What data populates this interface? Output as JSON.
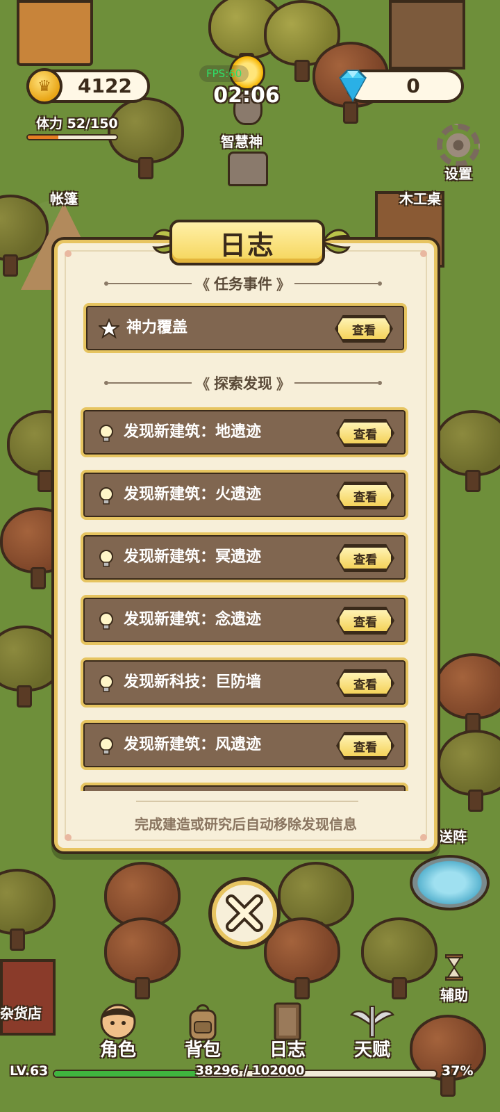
{
  "hud": {
    "coins": "4122",
    "stamina_label": "体力 52/150",
    "stamina_fraction": 0.3467,
    "fps_label": "FPS:60",
    "time": "02:06",
    "gems": "0",
    "settings_label": "设置"
  },
  "scenery": {
    "statue_label": "智慧神",
    "tent_label": "帐篷",
    "workbench_label": "木工桌",
    "portal_label": "送阵",
    "shop_label": "杂货店"
  },
  "dialog": {
    "title": "日志",
    "section_tasks": "任务事件",
    "task_items": [
      {
        "text": "神力覆盖",
        "button": "查看",
        "icon": "star-icon"
      }
    ],
    "section_discoveries": "探索发现",
    "discovery_items": [
      {
        "text": "发现新建筑：地遗迹",
        "button": "查看",
        "icon": "lightbulb-icon"
      },
      {
        "text": "发现新建筑：火遗迹",
        "button": "查看",
        "icon": "lightbulb-icon"
      },
      {
        "text": "发现新建筑：冥遗迹",
        "button": "查看",
        "icon": "lightbulb-icon"
      },
      {
        "text": "发现新建筑：念遗迹",
        "button": "查看",
        "icon": "lightbulb-icon"
      },
      {
        "text": "发现新科技：巨防墙",
        "button": "查看",
        "icon": "lightbulb-icon"
      },
      {
        "text": "发现新建筑：风遗迹",
        "button": "查看",
        "icon": "lightbulb-icon"
      }
    ],
    "footer_note": "完成建造或研究后自动移除发现信息"
  },
  "nav": {
    "assist_label": "辅助",
    "items": [
      {
        "label": "角色",
        "icon": "character-icon"
      },
      {
        "label": "背包",
        "icon": "backpack-icon"
      },
      {
        "label": "日志",
        "icon": "journal-icon"
      },
      {
        "label": "天赋",
        "icon": "talent-wings-icon"
      }
    ]
  },
  "progress": {
    "level": "LV.63",
    "xp_text": "38296 / 102000",
    "xp_percent": "37%",
    "xp_fraction": 0.3755
  },
  "colors": {
    "panel_bg": "#f7efd9",
    "panel_border": "#e7c461",
    "row_bg": "#806650",
    "outline": "#3a2a1a",
    "xp_green": "#3fb53f",
    "stamina_orange": "#e67e22"
  }
}
